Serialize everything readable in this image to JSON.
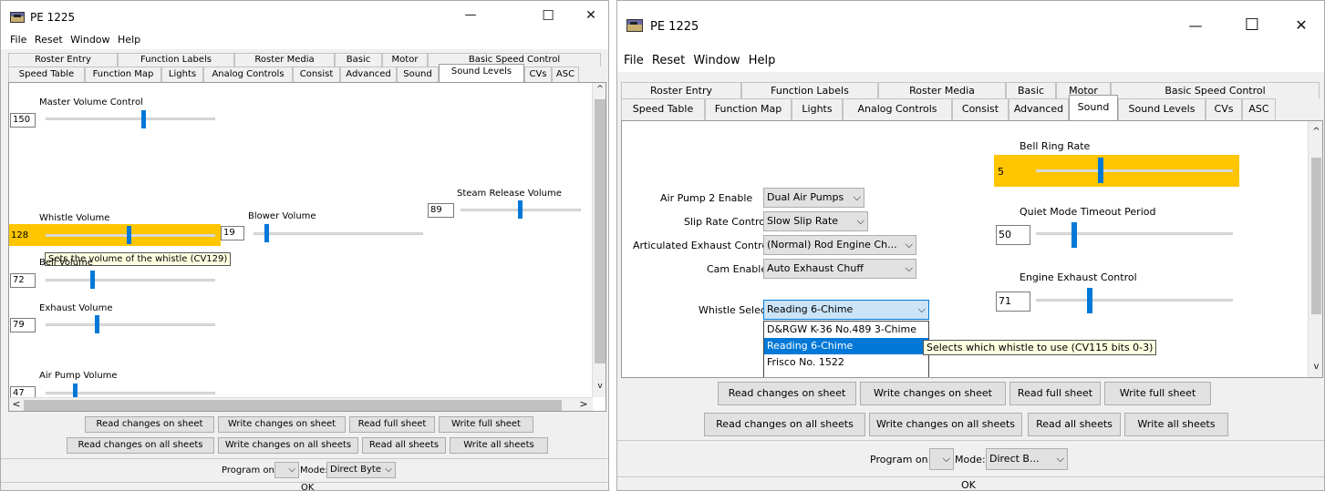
{
  "left": {
    "title": "PE 1225",
    "window_controls": {
      "min": "—",
      "max": "☐",
      "close": "✕"
    },
    "menu": [
      "File",
      "Reset",
      "Window",
      "Help"
    ],
    "tabs_row1": [
      "Roster Entry",
      "Function Labels",
      "Roster Media",
      "Basic",
      "Motor",
      "Basic Speed Control"
    ],
    "tabs_row2": [
      "Speed Table",
      "Function Map",
      "Lights",
      "Analog Controls",
      "Consist",
      "Advanced",
      "Sound",
      "Sound Levels",
      "CVs",
      "ASC"
    ],
    "active_tab": "Sound Levels",
    "sliders": {
      "master": {
        "label": "Master Volume Control",
        "value": "150",
        "level": 0.58
      },
      "whistle": {
        "label": "Whistle Volume",
        "value": "128",
        "level": 0.5
      },
      "blower": {
        "label": "Blower Volume",
        "value": "19",
        "level": 0.07
      },
      "steam": {
        "label": "Steam Release Volume",
        "value": "89",
        "level": 0.45
      },
      "bell": {
        "label": "Bell Volume",
        "value": "72",
        "level": 0.28
      },
      "exhaust": {
        "label": "Exhaust Volume",
        "value": "79",
        "level": 0.31
      },
      "airpump": {
        "label": "Air Pump Volume",
        "value": "47",
        "level": 0.18
      }
    },
    "tooltip": "Sets the volume of the whistle (CV129)",
    "buttons_row1": [
      "Read changes on sheet",
      "Write changes on sheet",
      "Read full sheet",
      "Write full sheet"
    ],
    "buttons_row2": [
      "Read changes on all sheets",
      "Write changes on all sheets",
      "Read all sheets",
      "Write all sheets"
    ],
    "program_on_label": "Program on:",
    "program_on_value": "",
    "mode_label": "Mode:",
    "mode_value": "Direct Byte",
    "ok": "OK",
    "highlight_color": "#ffc600",
    "accent_color": "#0078d7"
  },
  "right": {
    "title": "PE 1225",
    "window_controls": {
      "min": "—",
      "max": "☐",
      "close": "✕"
    },
    "menu": [
      "File",
      "Reset",
      "Window",
      "Help"
    ],
    "tabs_row1": [
      "Roster Entry",
      "Function Labels",
      "Roster Media",
      "Basic",
      "Motor",
      "Basic Speed Control"
    ],
    "tabs_row2": [
      "Speed Table",
      "Function Map",
      "Lights",
      "Analog Controls",
      "Consist",
      "Advanced",
      "Sound",
      "Sound Levels",
      "CVs",
      "ASC"
    ],
    "active_tab": "Sound",
    "combos": [
      {
        "label": "Air Pump 2 Enable",
        "value": "Dual Air Pumps"
      },
      {
        "label": "Slip Rate Control",
        "value": "Slow Slip Rate"
      },
      {
        "label": "Articulated Exhaust Control",
        "value": "(Normal) Rod Engine Ch..."
      },
      {
        "label": "Cam Enable",
        "value": "Auto Exhaust Chuff"
      }
    ],
    "whistle_select": {
      "label": "Whistle Select",
      "value": "Reading 6-Chime"
    },
    "whistle_options": [
      "D&RGW K-36 No.489 3-Chime",
      "Reading 6-Chime",
      "Frisco No. 1522"
    ],
    "whistle_tooltip": "Selects which whistle to use (CV115 bits 0-3)",
    "sliders": {
      "bell_ring": {
        "label": "Bell Ring Rate",
        "value": "5",
        "level": 0.3
      },
      "quiet": {
        "label": "Quiet Mode Timeout Period",
        "value": "50",
        "level": 0.2
      },
      "exhaust_ctl": {
        "label": "Engine Exhaust Control",
        "value": "71",
        "level": 0.28
      }
    },
    "buttons_row1": [
      "Read changes on sheet",
      "Write changes on sheet",
      "Read full sheet",
      "Write full sheet"
    ],
    "buttons_row2": [
      "Read changes on all sheets",
      "Write changes on all sheets",
      "Read all sheets",
      "Write all sheets"
    ],
    "program_on_label": "Program on:",
    "program_on_value": "",
    "mode_label": "Mode:",
    "mode_value": "Direct B...",
    "ok": "OK"
  }
}
